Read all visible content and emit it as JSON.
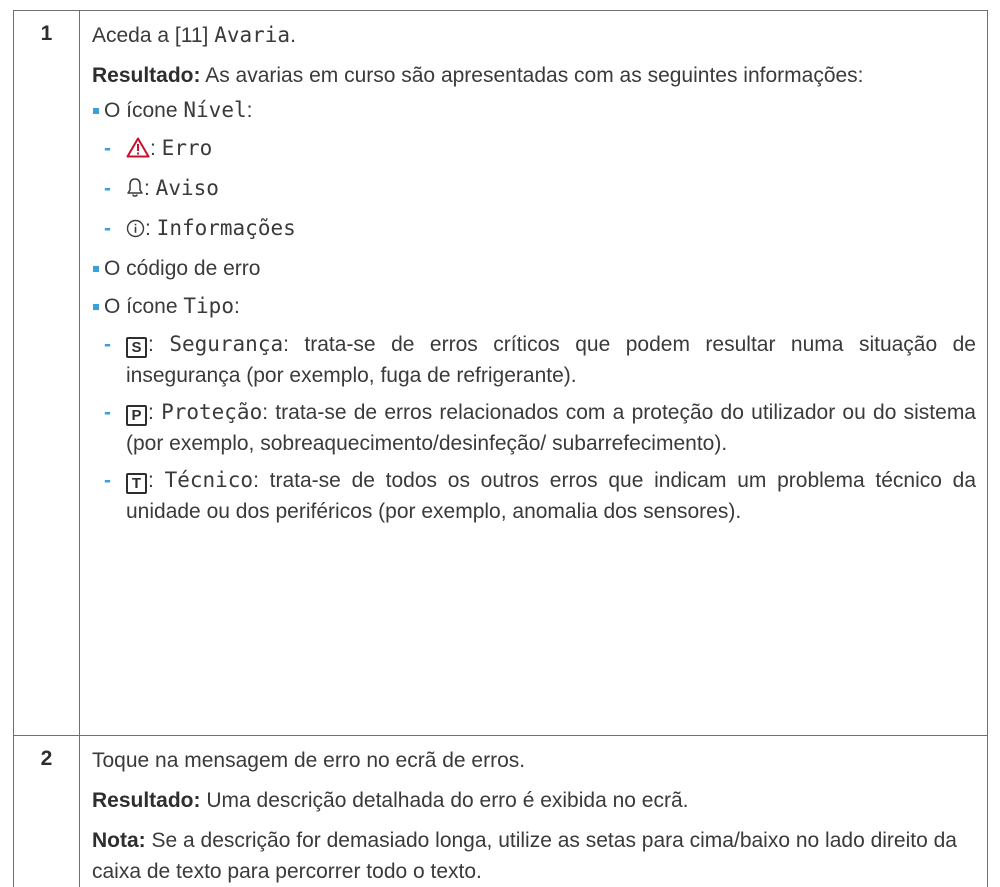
{
  "steps": [
    {
      "number": "1",
      "intro_prefix": "Aceda a [11] ",
      "intro_menu": "Avaria",
      "intro_suffix": ".",
      "result_label": "Resultado:",
      "result_text": " As avarias em curso são apresentadas com as seguintes informações:",
      "bullets": [
        {
          "prefix": "O ícone ",
          "mono": "Nível",
          "suffix": ":"
        },
        {
          "text": "O código de erro"
        },
        {
          "prefix": "O ícone ",
          "mono": "Tipo",
          "suffix": ":"
        }
      ],
      "levels": [
        {
          "icon": "warning-triangle-icon",
          "color": "#c8102e",
          "sep": ": ",
          "mono": "Erro"
        },
        {
          "icon": "bell-icon",
          "color": "#3a3a3a",
          "sep": ": ",
          "mono": "Aviso"
        },
        {
          "icon": "info-circle-icon",
          "color": "#3a3a3a",
          "sep": ": ",
          "mono": "Informações"
        }
      ],
      "types": [
        {
          "icon_letter": "S",
          "sep": ": ",
          "mono": "Segurança",
          "text": ": trata-se de erros críticos que podem resultar numa situação de insegurança (por exemplo, fuga de refrigerante)."
        },
        {
          "icon_letter": "P",
          "sep": ": ",
          "mono": "Proteção",
          "text": ": trata-se de erros relacionados com a proteção do utilizador ou do sistema (por exemplo, sobreaquecimento/desinfeção/ subarrefecimento)."
        },
        {
          "icon_letter": "T",
          "sep": ": ",
          "mono": "Técnico",
          "text": ": trata-se de todos os outros erros que indicam um problema técnico da unidade ou dos periféricos (por exemplo, anomalia dos sensores)."
        }
      ]
    },
    {
      "number": "2",
      "intro": "Toque na mensagem de erro no ecrã de erros.",
      "result_label": "Resultado:",
      "result_text": " Uma descrição detalhada do erro é exibida no ecrã.",
      "note_label": "Nota:",
      "note_text": " Se a descrição for demasiado longa, utilize as setas para cima/baixo no lado direito da caixa de texto para percorrer todo o texto."
    }
  ],
  "colors": {
    "bullet": "#3aa0d8",
    "error_icon": "#c8102e",
    "border": "#6f6f6f"
  }
}
